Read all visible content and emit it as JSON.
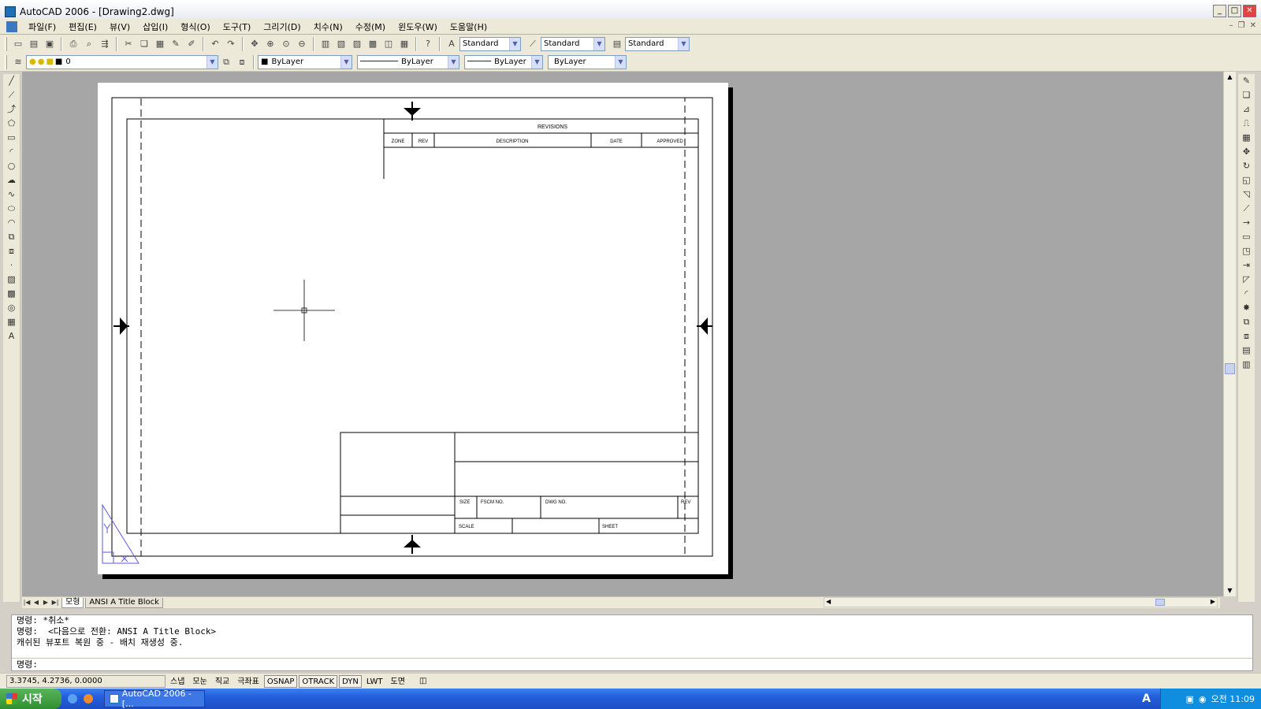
{
  "window": {
    "title": "AutoCAD 2006 - [Drawing2.dwg]",
    "buttons": [
      "_",
      "□",
      "✕"
    ]
  },
  "menu": [
    "파일(F)",
    "편집(E)",
    "뷰(V)",
    "삽입(I)",
    "형식(O)",
    "도구(T)",
    "그리기(D)",
    "치수(N)",
    "수정(M)",
    "윈도우(W)",
    "도움말(H)"
  ],
  "toolbar": {
    "text_style": "Standard",
    "dim_style": "Standard",
    "table_style": "Standard"
  },
  "layers": {
    "current_layer": "0",
    "color": "ByLayer",
    "linetype": "ByLayer",
    "lineweight": "ByLayer",
    "plotstyle": "ByLayer"
  },
  "drawing": {
    "revisions_title": "REVISIONS",
    "rev_cols": [
      "ZONE",
      "REV",
      "DESCRIPTION",
      "DATE",
      "APPROVED"
    ],
    "tb_size": "SIZE",
    "tb_fscm": "FSCM NO.",
    "tb_dwg": "DWG NO.",
    "tb_rev": "REV",
    "tb_scale": "SCALE",
    "tb_sheet": "SHEET"
  },
  "layout_tabs": {
    "model": "모형",
    "layout": "ANSI A Title Block"
  },
  "command": {
    "line1": "명령: *취소*",
    "line2": "명령:  <다음으로 전환: ANSI A Title Block>",
    "line3": "캐쉬된 뷰포트 복원 중 - 배치 재생성 중.",
    "prompt": "명령:"
  },
  "status": {
    "coords": "3.3745, 4.2736, 0.0000",
    "toggles": [
      "스냅",
      "모눈",
      "직교",
      "극좌표",
      "OSNAP",
      "OTRACK",
      "DYN",
      "LWT",
      "도면"
    ]
  },
  "taskbar": {
    "start": "시작",
    "task": "AutoCAD 2006 - [...",
    "clock": "오전 11:09"
  }
}
